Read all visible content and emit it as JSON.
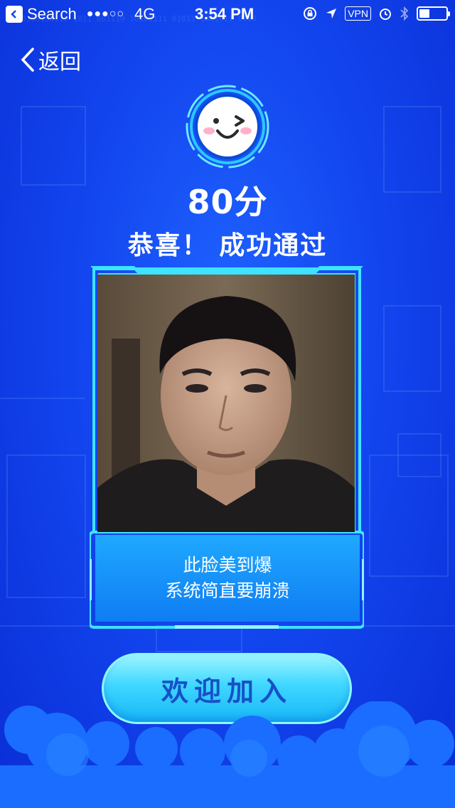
{
  "status_bar": {
    "back_app_label": "Search",
    "signal": "●●●○○",
    "network": "4G",
    "time": "3:54 PM",
    "vpn": "VPN"
  },
  "nav": {
    "back_label": "返回"
  },
  "result": {
    "score": "80分",
    "message": "恭喜！ 成功通过"
  },
  "caption": {
    "line1": "此脸美到爆",
    "line2": "系统简直要崩溃"
  },
  "join_button": {
    "label": "欢迎加入"
  },
  "colors": {
    "background": "#1346ef",
    "frame_cyan": "#3ee3ff",
    "caption_blue": "#1fa9ff",
    "button_text": "#1651c9",
    "crowd": "#1a6dff"
  },
  "battery_level": 0.36
}
